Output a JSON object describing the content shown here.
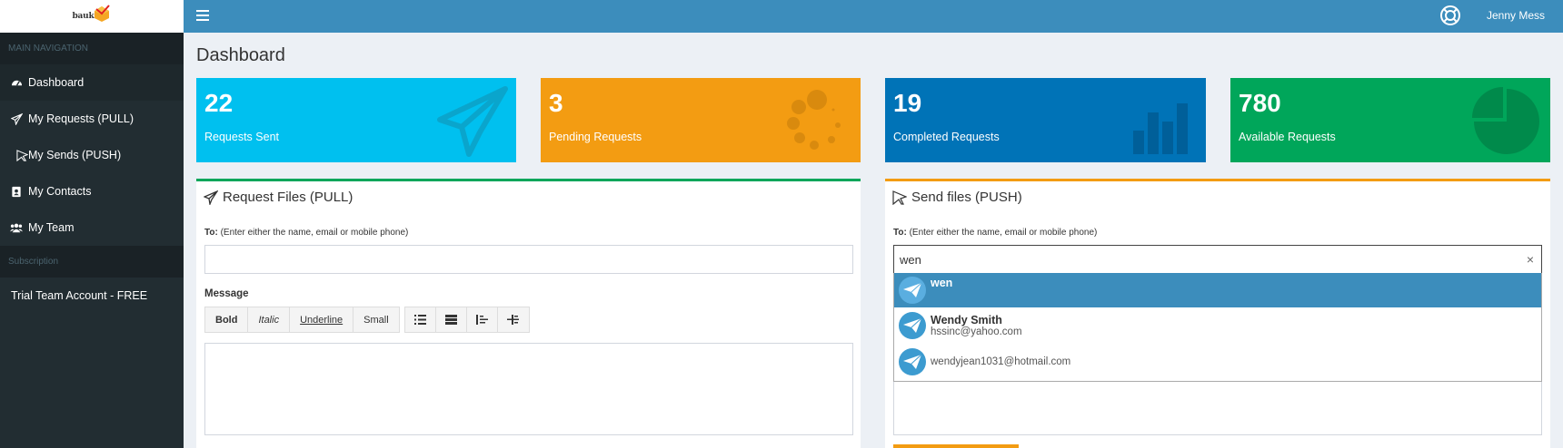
{
  "brand": {
    "logo_text": "bauk"
  },
  "sidebar": {
    "main_header": "MAIN NAVIGATION",
    "items": [
      {
        "label": "Dashboard",
        "icon": "dashboard-icon",
        "active": true
      },
      {
        "label": "My Requests (PULL)",
        "icon": "paper-plane-icon"
      },
      {
        "label": "My Sends (PUSH)",
        "icon": "cursor-send-icon"
      },
      {
        "label": "My Contacts",
        "icon": "address-book-icon"
      },
      {
        "label": "My Team",
        "icon": "users-icon"
      }
    ],
    "subscription_header": "Subscription",
    "plan": "Trial Team Account - FREE"
  },
  "header": {
    "user_name": "Jenny Mess",
    "menu_icon": "hamburger-icon",
    "support_icon": "life-ring-icon"
  },
  "page": {
    "title": "Dashboard"
  },
  "stats": [
    {
      "value": "22",
      "label": "Requests Sent",
      "color": "#00c0ef",
      "icon": "paper-plane-icon"
    },
    {
      "value": "3",
      "label": "Pending Requests",
      "color": "#f39c12",
      "icon": "spinner-icon"
    },
    {
      "value": "19",
      "label": "Completed Requests",
      "color": "#0073b7",
      "icon": "bar-chart-icon"
    },
    {
      "value": "780",
      "label": "Available Requests",
      "color": "#00a65a",
      "icon": "pie-chart-icon"
    }
  ],
  "pull": {
    "title": "Request Files (PULL)",
    "to_label": "To:",
    "to_hint": "(Enter either the name, email or mobile phone)",
    "to_value": "",
    "message_label": "Message",
    "toolbar": {
      "bold": "Bold",
      "italic": "Italic",
      "underline": "Underline",
      "small": "Small"
    }
  },
  "push": {
    "title": "Send files (PUSH)",
    "to_label": "To:",
    "to_hint": "(Enter either the name, email or mobile phone)",
    "to_value": "wen",
    "clear": "×",
    "suggestions": [
      {
        "name": "wen",
        "email": ""
      },
      {
        "name": "Wendy Smith",
        "email": "hssinc@yahoo.com"
      },
      {
        "name": "",
        "email": "wendyjean1031@hotmail.com"
      }
    ]
  }
}
